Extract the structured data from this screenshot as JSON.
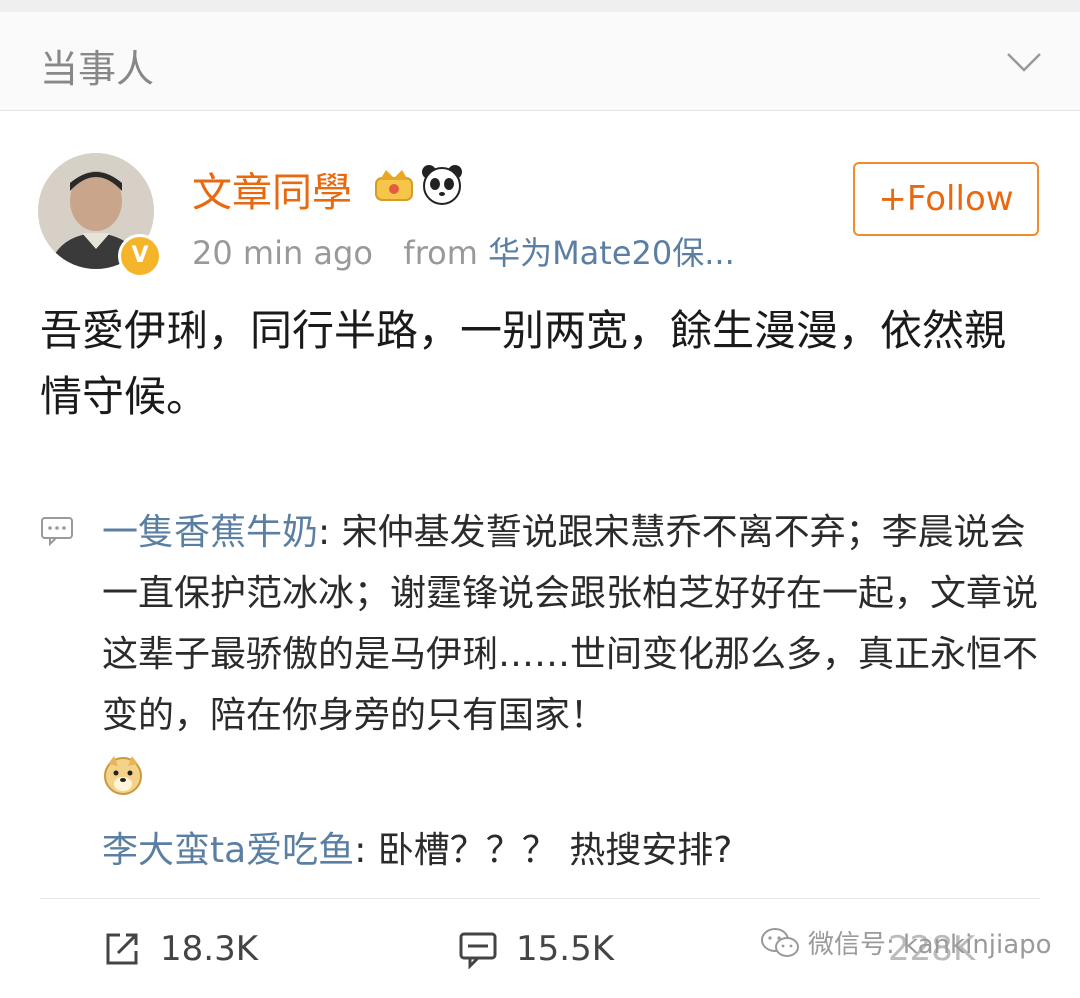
{
  "header": {
    "title": "当事人",
    "chevron_icon": "chevron-down-icon"
  },
  "post": {
    "author": "文章同學",
    "badges": [
      "crown-icon",
      "panda-icon"
    ],
    "verified_badge": "V",
    "time": "20 min ago",
    "from_label": "from",
    "device": "华为Mate20保...",
    "follow_label": "+Follow",
    "text": "吾愛伊琍，同行半路，一别两宽，餘生漫漫，依然親情守候。"
  },
  "comments": [
    {
      "user": "一隻香蕉牛奶",
      "text": ": 宋仲基发誓说跟宋慧乔不离不弃；李晨说会一直保护范冰冰；谢霆锋说会跟张柏芝好好在一起，文章说这辈子最骄傲的是马伊琍……世间变化那么多，真正永恒不变的，陪在你身旁的只有国家！",
      "emoji": "doge-icon"
    },
    {
      "user": "李大蛮ta爱吃鱼",
      "text": ": 卧槽？？？ 热搜安排?"
    }
  ],
  "actions": {
    "repost_count": "18.3K",
    "comment_count": "15.5K",
    "like_count": "228K"
  },
  "watermark": "微信号: kankinjiapo",
  "colors": {
    "username": "#e8690f",
    "link": "#5b7fa3",
    "follow_border": "#f08c2b"
  }
}
